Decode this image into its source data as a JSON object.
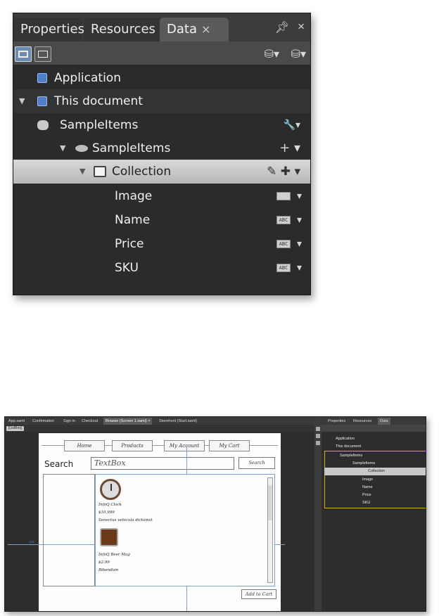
{
  "top_panel": {
    "tabs": [
      "Properties",
      "Resources",
      "Data"
    ],
    "active_tab_close": "×",
    "pin_icon": "pin-icon",
    "close_symbol": "×",
    "toolbar_right": [
      "⛁▾",
      "⛁▾"
    ],
    "rows": {
      "application": "Application",
      "this_document": "This document",
      "sample_items_source": "SampleItems",
      "sample_items": "SampleItems",
      "collection": "Collection",
      "image": "Image",
      "name": "Name",
      "price": "Price",
      "sku": "SKU"
    },
    "type_badges": {
      "text": "ABC"
    }
  },
  "ide": {
    "doc_tabs": [
      "App.xaml",
      "Confirmation",
      "Sign in",
      "Checkout",
      "Browse (Screen 1.xaml)",
      "Storefront (Start.xaml)"
    ],
    "active_doc_tab_index": 4,
    "scope_chip": "[ListBox]",
    "nav": [
      "Home",
      "Products",
      "My Account",
      "My Cart"
    ],
    "search_label": "Search",
    "search_box_text": "TextBox",
    "search_button": "Search",
    "items": [
      {
        "name": "InfoQ Clock",
        "price": "$10,999",
        "desc": "Senectus vehicula dictumst"
      },
      {
        "name": "InfoQ Beer Mug",
        "price": "$2.99",
        "desc": "Bibendum"
      }
    ],
    "add_to_cart": "Add to Cart",
    "guide_left": "133",
    "small_panel": {
      "tabs": [
        "Properties",
        "Resources",
        "Data"
      ],
      "rows": [
        "Application",
        "This document",
        "SampleItems",
        "SampleItems",
        "Collection",
        "Image",
        "Name",
        "Price",
        "SKU"
      ]
    }
  }
}
